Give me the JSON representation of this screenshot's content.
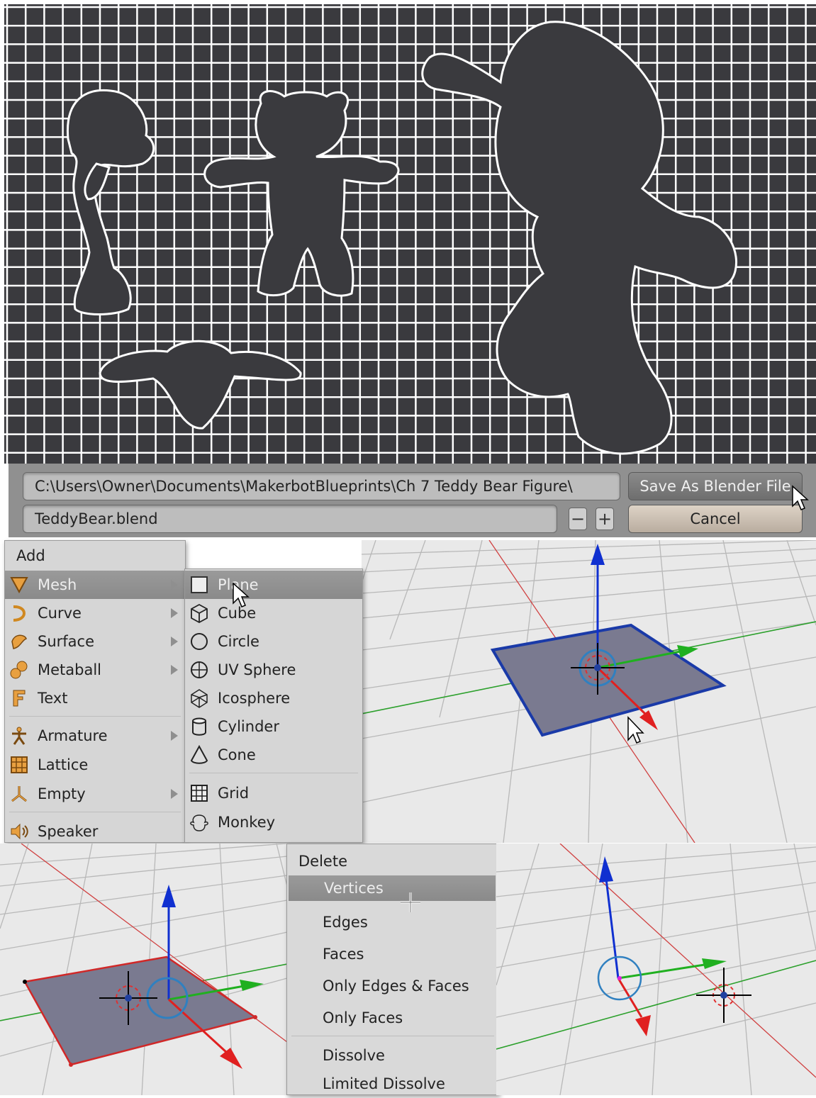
{
  "file_browser": {
    "path": "C:\\Users\\Owner\\Documents\\MakerbotBlueprints\\Ch 7 Teddy Bear Figure\\",
    "filename": "TeddyBear.blend",
    "save_label": "Save As Blender File",
    "cancel_label": "Cancel",
    "decrement_symbol": "−",
    "increment_symbol": "+"
  },
  "add_menu": {
    "title": "Add",
    "items": [
      {
        "label": "Mesh",
        "icon": "mesh-icon",
        "submenu": true,
        "selected": true
      },
      {
        "label": "Curve",
        "icon": "curve-icon",
        "submenu": true
      },
      {
        "label": "Surface",
        "icon": "surface-icon",
        "submenu": true
      },
      {
        "label": "Metaball",
        "icon": "metaball-icon",
        "submenu": true
      },
      {
        "label": "Text",
        "icon": "text-icon",
        "submenu": false
      },
      {
        "label": "Armature",
        "icon": "armature-icon",
        "submenu": true
      },
      {
        "label": "Lattice",
        "icon": "lattice-icon",
        "submenu": false
      },
      {
        "label": "Empty",
        "icon": "empty-icon",
        "submenu": true
      },
      {
        "label": "Speaker",
        "icon": "speaker-icon",
        "submenu": false
      }
    ]
  },
  "mesh_menu": {
    "items": [
      {
        "label": "Plane",
        "icon": "plane-icon",
        "selected": true
      },
      {
        "label": "Cube",
        "icon": "cube-icon"
      },
      {
        "label": "Circle",
        "icon": "circle-icon"
      },
      {
        "label": "UV Sphere",
        "icon": "uv-sphere-icon"
      },
      {
        "label": "Icosphere",
        "icon": "icosphere-icon"
      },
      {
        "label": "Cylinder",
        "icon": "cylinder-icon"
      },
      {
        "label": "Cone",
        "icon": "cone-icon"
      },
      {
        "label": "Grid",
        "icon": "grid-icon"
      },
      {
        "label": "Monkey",
        "icon": "monkey-icon"
      }
    ]
  },
  "delete_menu": {
    "title": "Delete",
    "items": [
      {
        "label": "Vertices",
        "selected": true
      },
      {
        "label": "Edges"
      },
      {
        "label": "Faces"
      },
      {
        "label": "Only Edges & Faces"
      },
      {
        "label": "Only Faces"
      },
      {
        "label": "Dissolve"
      },
      {
        "label": "Limited Dissolve"
      }
    ]
  },
  "colors": {
    "blueprint_bg": "#3a3a3e",
    "grid_line": "#ffffff",
    "axis_x": "#e02020",
    "axis_y": "#20b020",
    "axis_z": "#1030d0",
    "plane_fill": "#7a7a90",
    "plane_selected_edge": "#1a3aa8",
    "plane_edit_edge": "#d02828"
  }
}
